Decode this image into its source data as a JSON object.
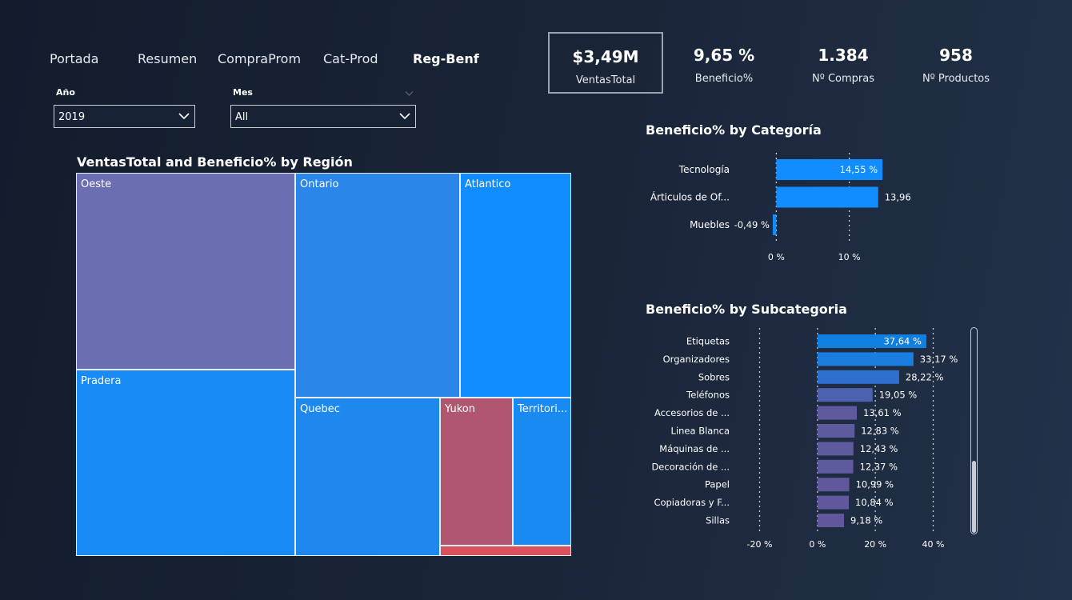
{
  "nav": {
    "items": [
      "Portada",
      "Resumen",
      "CompraProm",
      "Cat-Prod",
      "Reg-Benf"
    ],
    "active": "Reg-Benf"
  },
  "filters": {
    "year": {
      "label": "Año",
      "value": "2019"
    },
    "month": {
      "label": "Mes",
      "value": "All"
    }
  },
  "kpis": [
    {
      "value": "$3,49M",
      "label": "VentasTotal"
    },
    {
      "value": "9,65 %",
      "label": "Beneficio%"
    },
    {
      "value": "1.384",
      "label": "Nº Compras"
    },
    {
      "value": "958",
      "label": "Nº Productos"
    }
  ],
  "colors": {
    "accent_blue": "#118dff",
    "treemap_purple": "#6b6eb3",
    "treemap_red": "#b0566f"
  },
  "chart_data": [
    {
      "type": "treemap",
      "title": "VentasTotal and Beneficio% by Región",
      "nodes": [
        {
          "label": "Oeste",
          "color": "#6b6eb3"
        },
        {
          "label": "Ontario",
          "color": "#2a86e8"
        },
        {
          "label": "Atlantico",
          "color": "#118dff"
        },
        {
          "label": "Pradera",
          "color": "#198bf5"
        },
        {
          "label": "Quebec",
          "color": "#1f88ee"
        },
        {
          "label": "Yukon",
          "color": "#b0566f"
        },
        {
          "label": "Territori...",
          "color": "#1a8af3"
        },
        {
          "label": "",
          "color": "#d9525e"
        }
      ]
    },
    {
      "type": "bar",
      "orientation": "horizontal",
      "title": "Beneficio% by Categoría",
      "categories": [
        "Tecnología",
        "Árticulos de Of...",
        "Muebles"
      ],
      "values": [
        14.55,
        13.96,
        -0.49
      ],
      "labels": [
        "14,55 %",
        "13,96 %",
        "-0,49 %"
      ],
      "xlim": [
        -0.7,
        19.8
      ],
      "ticks": [
        0,
        10
      ],
      "tick_labels": [
        "0 %",
        "10 %"
      ],
      "grid": true
    },
    {
      "type": "bar",
      "orientation": "horizontal",
      "title": "Beneficio% by Subcategoria",
      "categories": [
        "Etiquetas",
        "Organizadores",
        "Sobres",
        "Teléfonos",
        "Accesorios de ...",
        "Linea Blanca",
        "Máquinas de ...",
        "Decoración de ...",
        "Papel",
        "Copiadoras y F...",
        "Sillas"
      ],
      "values": [
        37.64,
        33.17,
        28.22,
        19.05,
        13.61,
        12.83,
        12.43,
        12.37,
        10.99,
        10.84,
        9.18
      ],
      "labels": [
        "37,64 %",
        "33,17 %",
        "28,22 %",
        "19,05 %",
        "13,61 %",
        "12,83 %",
        "12,43 %",
        "12,37 %",
        "10,99 %",
        "10,84 %",
        "9,18 %"
      ],
      "colors": [
        "#0f7fe0",
        "#1a7ee0",
        "#2f70cf",
        "#4c62b0",
        "#5f5aa0",
        "#5d5a9e",
        "#5e5a9e",
        "#5e5a9e",
        "#60589b",
        "#60589b",
        "#61579a"
      ],
      "xlim": [
        -20,
        40
      ],
      "ticks": [
        -20,
        0,
        20,
        40
      ],
      "tick_labels": [
        "-20 %",
        "0 %",
        "20 %",
        "40 %"
      ],
      "grid": true
    }
  ]
}
